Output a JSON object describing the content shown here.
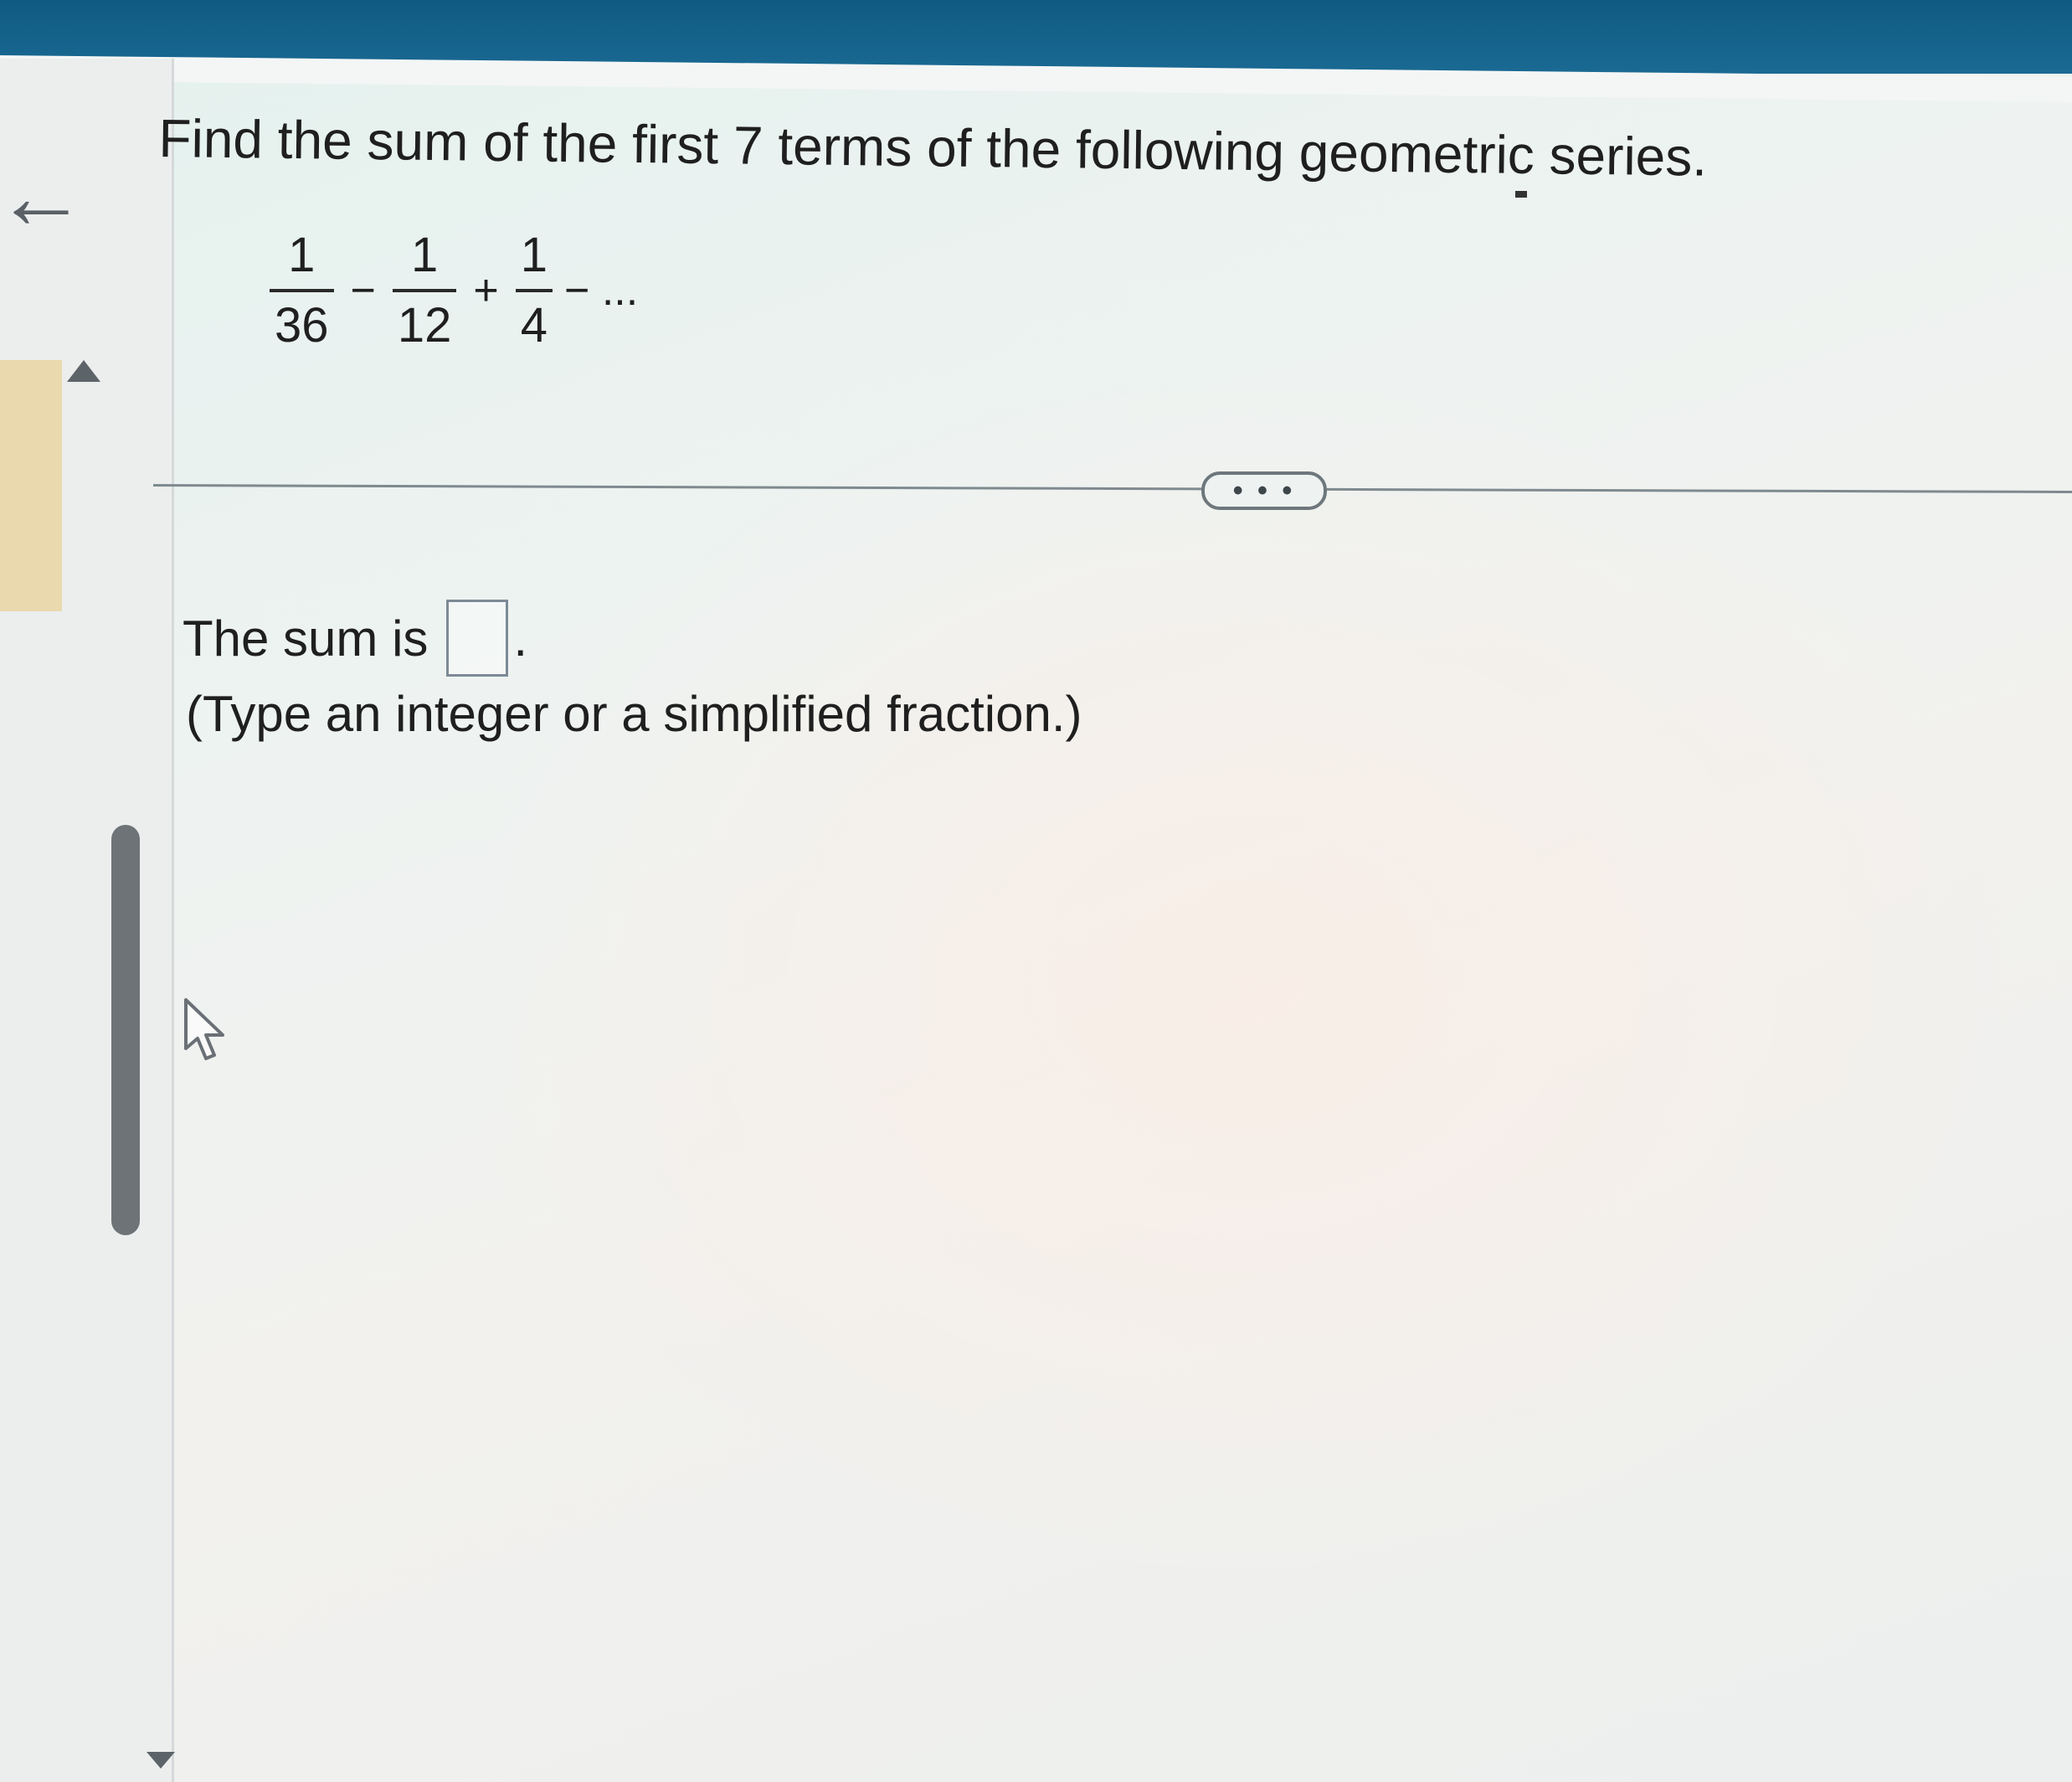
{
  "question": {
    "text": "Find the sum of the first 7 terms of the following geometric series."
  },
  "series": {
    "terms": [
      {
        "numerator": "1",
        "denominator": "36"
      },
      {
        "numerator": "1",
        "denominator": "12"
      },
      {
        "numerator": "1",
        "denominator": "4"
      }
    ],
    "operators": [
      "−",
      "+"
    ],
    "tail": "− ..."
  },
  "more_button": {
    "label": "• • •"
  },
  "answer": {
    "prefix": "The sum is",
    "value": "",
    "suffix": "."
  },
  "hint": {
    "text": "(Type an integer or a simplified fraction.)"
  },
  "icons": {
    "back": "back-arrow-icon",
    "scroll_up": "triangle-up-icon",
    "scroll_down": "triangle-down-icon",
    "cursor": "mouse-pointer-icon"
  },
  "colors": {
    "top_bar": "#0f5a83",
    "text": "#1f1f1f",
    "side_tab": "#ead9ae",
    "scroll_thumb": "#6e7378"
  }
}
